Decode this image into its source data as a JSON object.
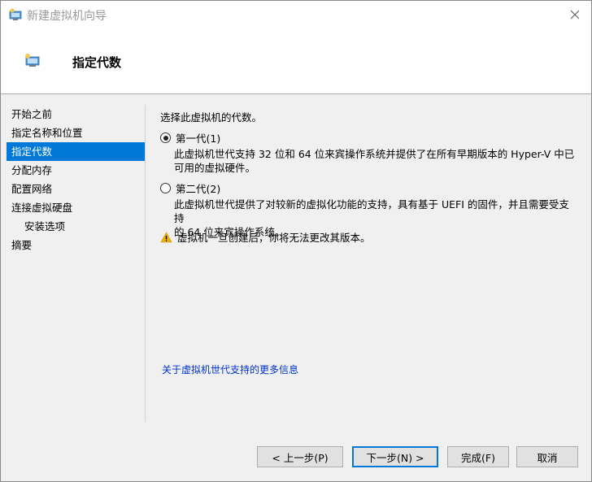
{
  "window": {
    "title": "新建虚拟机向导"
  },
  "header": {
    "title": "指定代数"
  },
  "nav": {
    "items": [
      {
        "label": "开始之前",
        "active": false,
        "sub": false
      },
      {
        "label": "指定名称和位置",
        "active": false,
        "sub": false
      },
      {
        "label": "指定代数",
        "active": true,
        "sub": false
      },
      {
        "label": "分配内存",
        "active": false,
        "sub": false
      },
      {
        "label": "配置网络",
        "active": false,
        "sub": false
      },
      {
        "label": "连接虚拟硬盘",
        "active": false,
        "sub": false
      },
      {
        "label": "安装选项",
        "active": false,
        "sub": true
      },
      {
        "label": "摘要",
        "active": false,
        "sub": false
      }
    ]
  },
  "main": {
    "intro": "选择此虚拟机的代数。",
    "gen1": {
      "label": "第一代(1)",
      "checked": true,
      "desc_line1": "此虚拟机世代支持 32 位和 64 位来宾操作系统并提供了在所有早期版本的 Hyper-V 中已",
      "desc_line2": "可用的虚拟硬件。"
    },
    "gen2": {
      "label": "第二代(2)",
      "checked": false,
      "desc_line1": "此虚拟机世代提供了对较新的虚拟化功能的支持，具有基于 UEFI 的固件，并且需要受支持",
      "desc_line2": "的 64 位来宾操作系统。"
    },
    "warning": "虚拟机一旦创建后，你将无法更改其版本。",
    "more_link": "关于虚拟机世代支持的更多信息"
  },
  "buttons": {
    "prev": "< 上一步(P)",
    "next": "下一步(N) >",
    "finish": "完成(F)",
    "cancel": "取消"
  },
  "colors": {
    "accent": "#0078d7",
    "link": "#0033cc",
    "warning": "#f0b400"
  },
  "icons": {
    "app": "hyper-v-vm-icon",
    "close": "close-icon",
    "warning": "warning-icon"
  }
}
